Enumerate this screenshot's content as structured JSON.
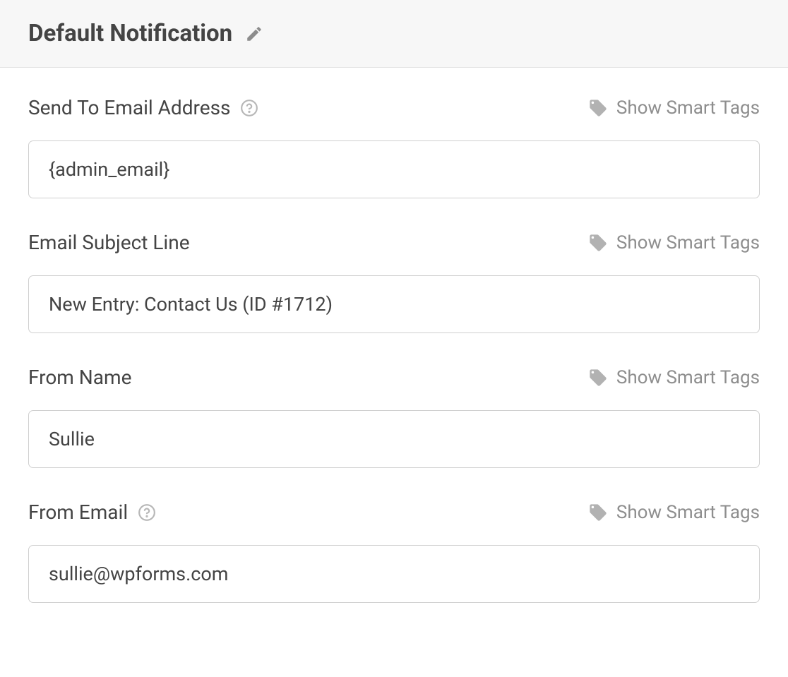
{
  "header": {
    "title": "Default Notification"
  },
  "fields": {
    "send_to": {
      "label": "Send To Email Address",
      "value": "{admin_email}",
      "smart_tags_label": "Show Smart Tags",
      "has_help": true
    },
    "subject": {
      "label": "Email Subject Line",
      "value": "New Entry: Contact Us (ID #1712)",
      "smart_tags_label": "Show Smart Tags",
      "has_help": false
    },
    "from_name": {
      "label": "From Name",
      "value": "Sullie",
      "smart_tags_label": "Show Smart Tags",
      "has_help": false
    },
    "from_email": {
      "label": "From Email",
      "value": "sullie@wpforms.com",
      "smart_tags_label": "Show Smart Tags",
      "has_help": true
    }
  }
}
